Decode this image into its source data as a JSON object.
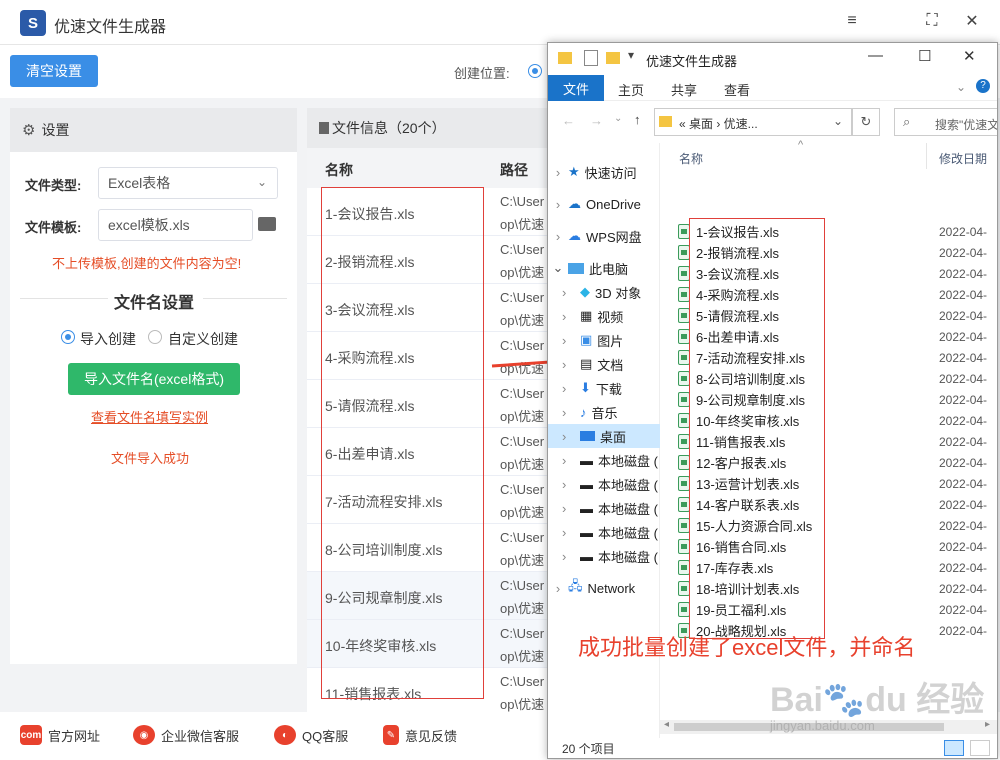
{
  "app": {
    "title": "优速文件生成器",
    "logo_letter": "S",
    "clear_button": "清空设置",
    "create_location_label": "创建位置:",
    "window_controls": [
      "≡",
      "⛶",
      "✕"
    ]
  },
  "settings": {
    "header": "设置",
    "file_type_label": "文件类型:",
    "file_type_value": "Excel表格",
    "template_label": "文件模板:",
    "template_value": "excel模板.xls",
    "warning": "不上传模板,创建的文件内容为空!",
    "filename_section_title": "文件名设置",
    "radio_import": "导入创建",
    "radio_custom": "自定义创建",
    "import_button": "导入文件名(excel格式)",
    "example_link": "查看文件名填写实例",
    "import_status": "文件导入成功"
  },
  "fileinfo": {
    "header": "文件信息（20个）",
    "col_name": "名称",
    "col_path": "路径",
    "rows": [
      {
        "name": "1-会议报告.xls",
        "path1": "C:\\User",
        "path2": "op\\优速"
      },
      {
        "name": "2-报销流程.xls",
        "path1": "C:\\User",
        "path2": "op\\优速"
      },
      {
        "name": "3-会议流程.xls",
        "path1": "C:\\User",
        "path2": "op\\优速"
      },
      {
        "name": "4-采购流程.xls",
        "path1": "C:\\User",
        "path2": "op\\优速"
      },
      {
        "name": "5-请假流程.xls",
        "path1": "C:\\User",
        "path2": "op\\优速"
      },
      {
        "name": "6-出差申请.xls",
        "path1": "C:\\User",
        "path2": "op\\优速"
      },
      {
        "name": "7-活动流程安排.xls",
        "path1": "C:\\User",
        "path2": "op\\优速"
      },
      {
        "name": "8-公司培训制度.xls",
        "path1": "C:\\User",
        "path2": "op\\优速"
      },
      {
        "name": "9-公司规章制度.xls",
        "path1": "C:\\User",
        "path2": "op\\优速"
      },
      {
        "name": "10-年终奖审核.xls",
        "path1": "C:\\User",
        "path2": "op\\优速"
      },
      {
        "name": "11-销售报表.xls",
        "path1": "C:\\User",
        "path2": "op\\优速"
      }
    ]
  },
  "footer": {
    "website": "官方网址",
    "wechat": "企业微信客服",
    "qq": "QQ客服",
    "feedback": "意见反馈"
  },
  "explorer": {
    "title": "优速文件生成器",
    "menu": [
      "文件",
      "主页",
      "共享",
      "查看"
    ],
    "address": "«  桌面  ›  优速...",
    "search_placeholder": "搜索\"优速文",
    "col_name": "名称",
    "col_date": "修改日期",
    "tree": [
      "快速访问",
      "OneDrive",
      "WPS网盘",
      "此电脑",
      "3D 对象",
      "视频",
      "图片",
      "文档",
      "下载",
      "音乐",
      "桌面",
      "本地磁盘 (",
      "本地磁盘 (",
      "本地磁盘 (",
      "本地磁盘 (",
      "本地磁盘 (",
      "Network"
    ],
    "files": [
      "1-会议报告.xls",
      "2-报销流程.xls",
      "3-会议流程.xls",
      "4-采购流程.xls",
      "5-请假流程.xls",
      "6-出差申请.xls",
      "7-活动流程安排.xls",
      "8-公司培训制度.xls",
      "9-公司规章制度.xls",
      "10-年终奖审核.xls",
      "11-销售报表.xls",
      "12-客户报表.xls",
      "13-运营计划表.xls",
      "14-客户联系表.xls",
      "15-人力资源合同.xls",
      "16-销售合同.xls",
      "17-库存表.xls",
      "18-培训计划表.xls",
      "19-员工福利.xls",
      "20-战略规划.xls"
    ],
    "date_prefix": "2022-04-",
    "status": "20 个项目"
  },
  "caption": "成功批量创建了excel文件，并命名"
}
